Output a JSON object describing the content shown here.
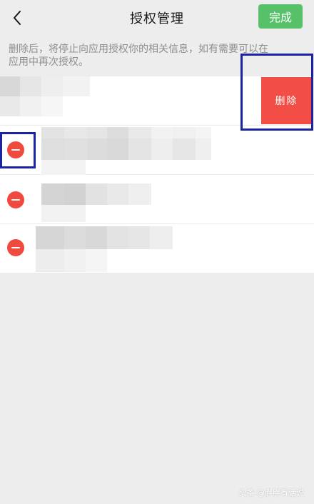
{
  "header": {
    "back_icon": "chevron-left-icon",
    "title": "授权管理",
    "done_label": "完成",
    "done_color": "#56c168"
  },
  "notice": {
    "line1": "删除后，将停止向应用授权你的相关信息，如有需要可以在",
    "line2": "应用中再次授权。"
  },
  "swipe_action": {
    "delete_label": "删除",
    "delete_color": "#f24e46"
  },
  "list": {
    "minus_icon": "minus-circle-icon",
    "minus_color": "#f0493e"
  },
  "highlight_color": "#1a23a6",
  "watermark": "头条 @胖胖有话说"
}
